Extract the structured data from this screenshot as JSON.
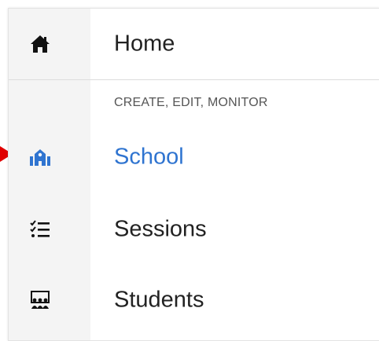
{
  "menu": {
    "home": {
      "label": "Home",
      "icon": "home-icon"
    },
    "section_caption": "CREATE, EDIT, MONITOR",
    "items": [
      {
        "label": "School",
        "icon": "school-icon",
        "active": true
      },
      {
        "label": "Sessions",
        "icon": "checklist-icon",
        "active": false
      },
      {
        "label": "Students",
        "icon": "classroom-icon",
        "active": false
      }
    ]
  },
  "colors": {
    "active": "#2f74d0",
    "text": "#222222",
    "rail": "#f4f4f4",
    "pointer": "#e00000"
  }
}
